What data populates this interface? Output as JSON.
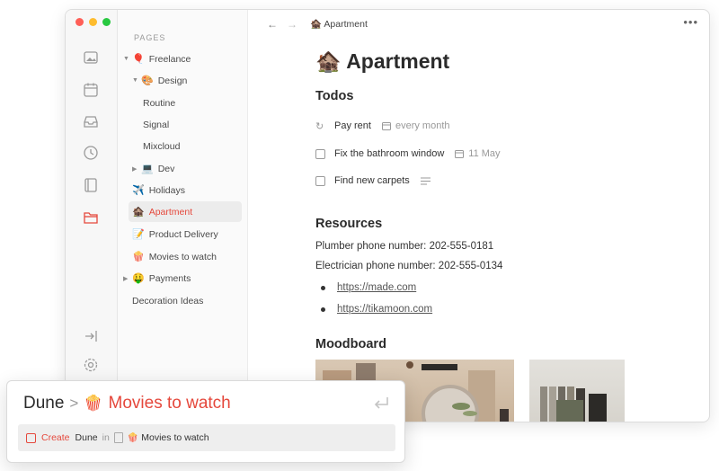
{
  "window": {
    "traffic_colors": [
      "#ff5f57",
      "#febc2e",
      "#28c840"
    ],
    "rail_icons": [
      "image-icon",
      "calendar-icon",
      "inbox-icon",
      "clock-icon",
      "notebook-icon",
      "folder-icon",
      "collapse-sidebar-icon",
      "settings-icon"
    ],
    "accent": "#e5483c"
  },
  "sidebar": {
    "header": "PAGES",
    "items": [
      {
        "label": "Freelance",
        "emoji": "🎈",
        "caret": "▼"
      },
      {
        "label": "Design",
        "emoji": "🎨",
        "caret": "▼"
      },
      {
        "label": "Routine"
      },
      {
        "label": "Signal"
      },
      {
        "label": "Mixcloud"
      },
      {
        "label": "Dev",
        "emoji": "💻",
        "caret": "▶"
      },
      {
        "label": "Holidays",
        "emoji": "✈️"
      },
      {
        "label": "Apartment",
        "emoji": "🏚️"
      },
      {
        "label": "Product Delivery",
        "emoji": "📝"
      },
      {
        "label": "Movies to watch",
        "emoji": "🍿"
      },
      {
        "label": "Payments",
        "emoji": "🤑",
        "caret": "▶"
      },
      {
        "label": "Decoration Ideas"
      }
    ]
  },
  "topbar": {
    "back": "←",
    "forward": "→",
    "breadcrumb_emoji": "🏚️",
    "breadcrumb": "Apartment",
    "more": "•••"
  },
  "page": {
    "emoji": "🏚️",
    "title": "Apartment",
    "todos_heading": "Todos",
    "todos": [
      {
        "label": "Pay rent",
        "meta": "every month",
        "kind": "recurring"
      },
      {
        "label": "Fix the bathroom window",
        "meta": "11 May",
        "kind": "checkbox"
      },
      {
        "label": "Find new carpets",
        "meta": "",
        "kind": "checkbox-notes"
      }
    ],
    "resources_heading": "Resources",
    "resources": [
      "Plumber phone number: 202-555-0181",
      "Electrician phone number: 202-555-0134"
    ],
    "links": [
      "https://made.com",
      "https://tikamoon.com"
    ],
    "moodboard_heading": "Moodboard"
  },
  "popup": {
    "query": "Dune",
    "separator": ">",
    "target_emoji": "🍿",
    "target": "Movies to watch",
    "result": {
      "create": "Create",
      "item": "Dune",
      "in": "in",
      "emoji": "🍿",
      "page": "Movies to watch"
    }
  }
}
